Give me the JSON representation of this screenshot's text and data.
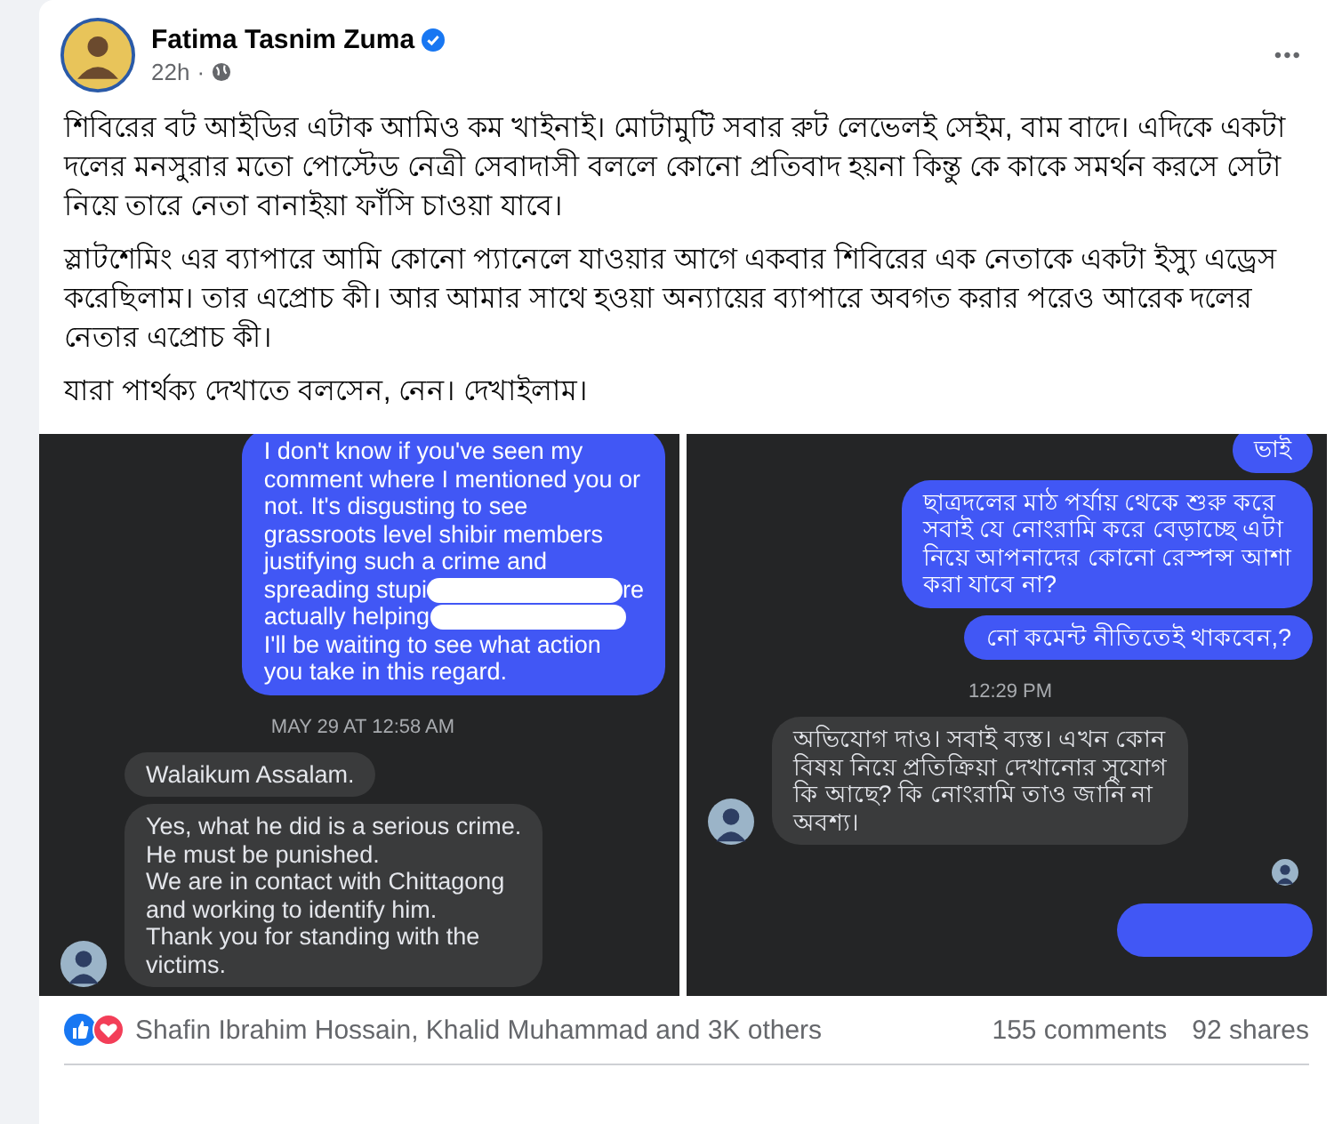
{
  "post": {
    "author": "Fatima Tasnim Zuma",
    "verified": true,
    "time": "22h",
    "separator": "·",
    "menu": "•••",
    "paragraphs": [
      "শিবিরের বট আইডির এটাক আমিও কম খাইনাই। মোটামুটি সবার রুট লেভেলই সেইম, বাম বাদে। এদিকে একটা দলের মনসুরার মতো পোস্টেড নেত্রী সেবাদাসী বললে কোনো প্রতিবাদ হয়না কিন্তু কে কাকে সমর্থন করসে সেটা নিয়ে তারে নেতা বানাইয়া ফাঁসি চাওয়া যাবে।",
      "স্লাটশেমিং এর ব্যাপারে আমি কোনো প্যানেলে যাওয়ার আগে একবার শিবিরের এক নেতাকে একটা ইস্যু এড্রেস করেছিলাম। তার এপ্রোচ কী। আর আমার সাথে হওয়া অন্যায়ের ব্যাপারে অবগত করার পরেও আরেক দলের নেতার এপ্রোচ কী।",
      "যারা পার্থক্য দেখাতে বলসেন, নেন। দেখাইলাম।"
    ]
  },
  "screenshots": [
    {
      "messages": [
        {
          "kind": "sent",
          "lines": [
            "I don't know if you've seen my",
            "comment where I mentioned you or",
            "not. It's disgusting to see",
            "grassroots level shibir members",
            "justifying such a crime and",
            [
              {
                "kind": "text",
                "text": "spreading stupi"
              },
              {
                "kind": "redacted"
              },
              {
                "kind": "text",
                "text": "re"
              }
            ],
            [
              {
                "kind": "text",
                "text": "actually helping"
              },
              {
                "kind": "redacted"
              }
            ],
            "I'll be waiting to see what action",
            "you take in this regard."
          ]
        },
        {
          "kind": "time",
          "text": "MAY 29 AT 12:58 AM"
        },
        {
          "kind": "received",
          "lines": [
            "Walaikum Assalam."
          ]
        },
        {
          "kind": "received",
          "avatar": true,
          "lines": [
            "Yes, what he did is a serious crime.",
            "He must be punished.",
            "We are in contact with Chittagong",
            "and working to identify him.",
            "Thank you for standing with the",
            "victims."
          ]
        }
      ]
    },
    {
      "messages": [
        {
          "kind": "sent",
          "lines": [
            "ভাই"
          ]
        },
        {
          "kind": "sent",
          "lines": [
            "ছাত্রদলের মাঠ পর্যায় থেকে শুরু করে",
            "সবাই যে নোংরামি করে বেড়াচ্ছে এটা",
            "নিয়ে আপনাদের কোনো রেস্পন্স আশা",
            "করা যাবে না?"
          ]
        },
        {
          "kind": "sent",
          "lines": [
            "নো কমেন্ট নীতিতেই থাকবেন,?"
          ]
        },
        {
          "kind": "time",
          "text": "12:29 PM"
        },
        {
          "kind": "received",
          "avatar": true,
          "lines": [
            "অভিযোগ দাও।  সবাই ব্যস্ত।  এখন কোন",
            "বিষয় নিয়ে প্রতিক্রিয়া দেখানোর সুযোগ",
            "কি আছে?  কি নোংরামি তাও জানি না",
            "অবশ্য।"
          ]
        },
        {
          "kind": "seen"
        },
        {
          "kind": "cut"
        }
      ]
    }
  ],
  "footer": {
    "reactions": "Shafin Ibrahim Hossain, Khalid Muhammad and 3K others",
    "comments": "155 comments",
    "shares": "92 shares"
  }
}
